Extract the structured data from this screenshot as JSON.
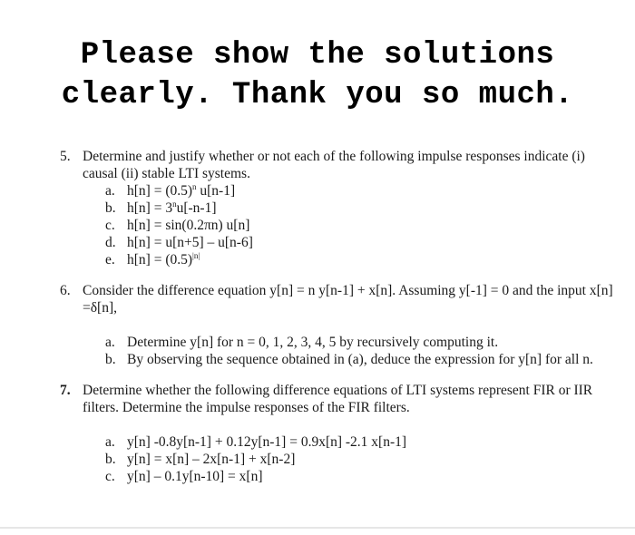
{
  "header": {
    "line1": "Please show the solutions",
    "line2": "clearly. Thank you so much."
  },
  "questions": [
    {
      "number": "5.",
      "text": "Determine and justify whether or not each of the following impulse responses indicate (i) causal (ii) stable LTI systems.",
      "items": [
        {
          "label": "a.",
          "pre": "h[n] = (0.5)",
          "sup": "n",
          "post": " u[n-1]"
        },
        {
          "label": "b.",
          "pre": "h[n] = 3",
          "sup": "n",
          "post": "u[-n-1]"
        },
        {
          "label": "c.",
          "pre": "h[n] = sin(0.2πn) u[n]",
          "sup": "",
          "post": ""
        },
        {
          "label": "d.",
          "pre": "h[n] = u[n+5] – u[n-6]",
          "sup": "",
          "post": ""
        },
        {
          "label": "e.",
          "pre": "h[n] = (0.5)",
          "sup": "|n|",
          "post": ""
        }
      ]
    },
    {
      "number": "6.",
      "text": "Consider the difference equation y[n] = n y[n-1] + x[n]. Assuming y[-1] = 0 and the input x[n] =δ[n],",
      "items": [
        {
          "label": "a.",
          "text": "Determine y[n] for n = 0, 1, 2, 3, 4, 5  by recursively computing it."
        },
        {
          "label": "b.",
          "text": "By observing the sequence obtained in (a), deduce the expression for y[n] for all n."
        }
      ]
    },
    {
      "number": "7.",
      "text": "Determine whether the following difference equations of LTI systems represent FIR or IIR filters. Determine the impulse responses of the FIR filters.",
      "items": [
        {
          "label": "a.",
          "text": "y[n] -0.8y[n-1] + 0.12y[n-1] = 0.9x[n] -2.1 x[n-1]"
        },
        {
          "label": "b.",
          "text": "y[n] = x[n] – 2x[n-1] + x[n-2]"
        },
        {
          "label": "c.",
          "text": "y[n] – 0.1y[n-10] = x[n]"
        }
      ]
    }
  ]
}
